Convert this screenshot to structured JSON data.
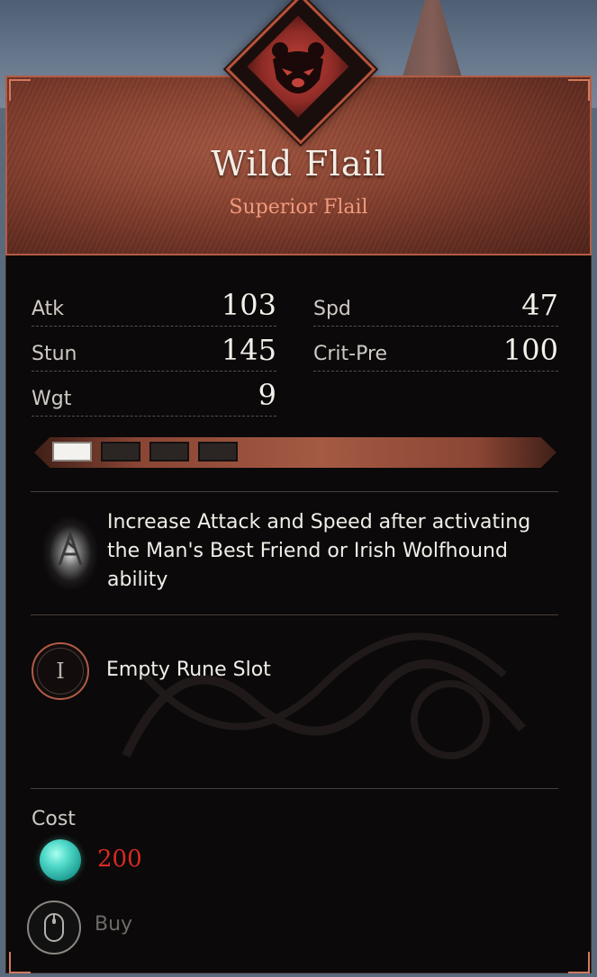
{
  "item": {
    "name": "Wild Flail",
    "type": "Superior Flail",
    "emblem_icon": "bear-icon"
  },
  "stats": {
    "left": [
      {
        "label": "Atk",
        "value": "103"
      },
      {
        "label": "Stun",
        "value": "145"
      },
      {
        "label": "Wgt",
        "value": "9"
      }
    ],
    "right": [
      {
        "label": "Spd",
        "value": "47"
      },
      {
        "label": "Crit-Pre",
        "value": "100"
      }
    ]
  },
  "upgrade": {
    "filled": 1,
    "total": 4
  },
  "perk": {
    "icon": "wolf-rune-icon",
    "text": "Increase Attack and Speed after activating the Man's Best Friend or Irish Wolfhound ability"
  },
  "rune_slot": {
    "numeral": "I",
    "label": "Empty Rune Slot"
  },
  "cost": {
    "label": "Cost",
    "value": "200",
    "currency_icon": "opal-icon"
  },
  "action": {
    "label": "Buy",
    "icon": "mouse-icon"
  },
  "colors": {
    "accent": "#b5533c",
    "cost_value": "#d92a22",
    "subtitle": "#f09a7e"
  }
}
